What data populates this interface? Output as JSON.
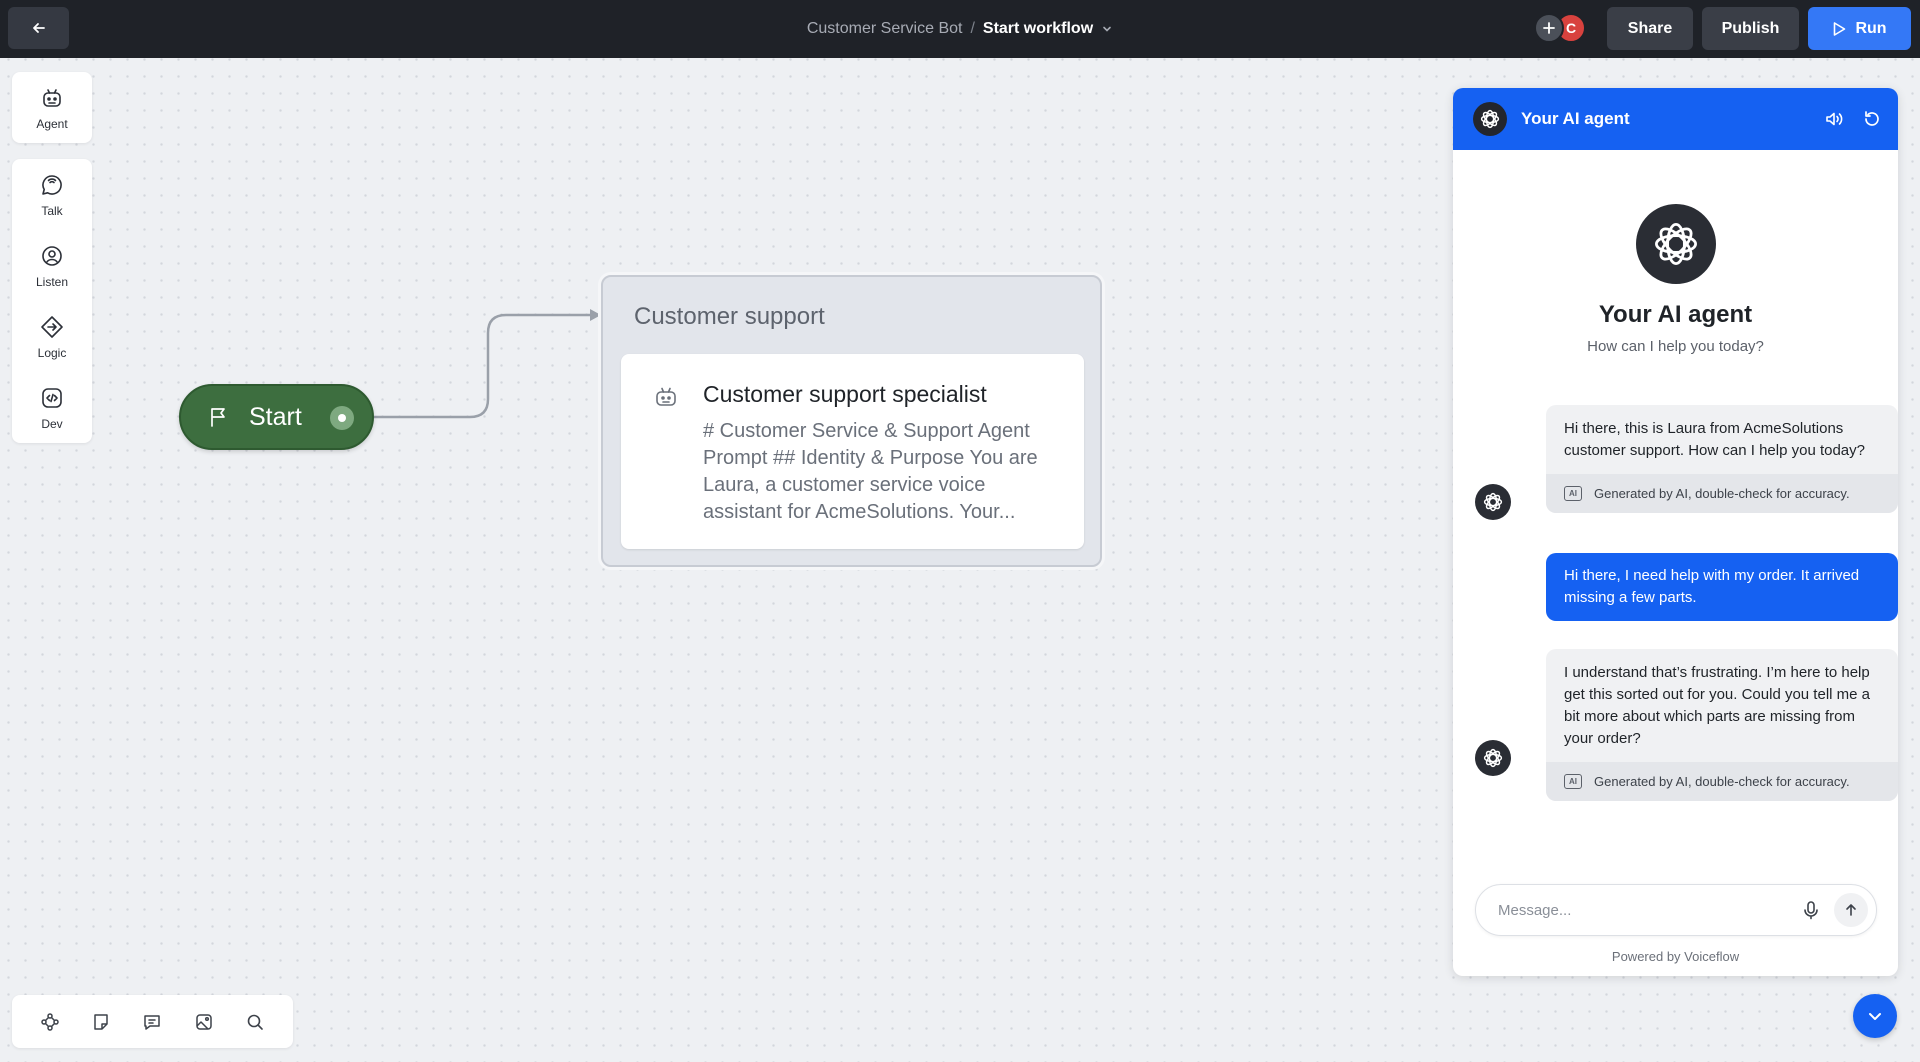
{
  "topbar": {
    "back_icon": "arrow-left-icon",
    "project_name": "Customer Service Bot",
    "separator": "/",
    "workflow_name": "Start workflow",
    "avatar_initial": "C",
    "share_label": "Share",
    "publish_label": "Publish",
    "run_label": "Run",
    "run_color": "#3478f6"
  },
  "toolbar": {
    "agent_label": "Agent",
    "talk_label": "Talk",
    "listen_label": "Listen",
    "logic_label": "Logic",
    "dev_label": "Dev"
  },
  "bottom_tools": [
    "nodes-icon",
    "note-icon",
    "comment-icon",
    "image-icon",
    "search-icon"
  ],
  "canvas": {
    "start_label": "Start",
    "start_color": "#3d6e3f",
    "block_title": "Customer support",
    "step_title": "Customer support specialist",
    "step_body": "# Customer Service & Support Agent Prompt ## Identity & Purpose You are Laura, a customer service voice assistant for AcmeSolutions. Your..."
  },
  "chat": {
    "header_title": "Your AI agent",
    "header_color": "#1561f2",
    "hero_title": "Your AI agent",
    "hero_subtitle": "How can I help you today?",
    "messages": [
      {
        "role": "agent",
        "text": "Hi there, this is Laura from AcmeSolutions customer support. How can I help you today?",
        "footer": "Generated by AI, double-check for accuracy."
      },
      {
        "role": "user",
        "text": "Hi there, I need help with my order. It arrived missing a few parts."
      },
      {
        "role": "agent",
        "text": "I understand that’s frustrating. I’m here to help get this sorted out for you. Could you tell me a bit more about which parts are missing from your order?",
        "footer": "Generated by AI, double-check for accuracy."
      }
    ],
    "ai_badge": "AI",
    "input_placeholder": "Message...",
    "powered_by": "Powered by Voiceflow"
  }
}
